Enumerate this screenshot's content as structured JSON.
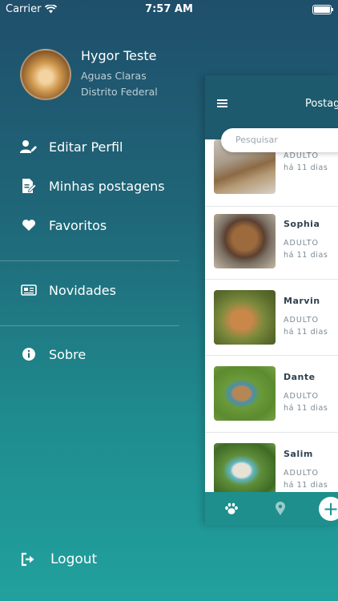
{
  "status_bar": {
    "carrier": "Carrier",
    "time": "7:57 AM"
  },
  "profile": {
    "name": "Hygor Teste",
    "city": "Aguas Claras",
    "state": "Distrito Federal"
  },
  "menu": {
    "edit_profile": "Editar Perfil",
    "my_posts": "Minhas postagens",
    "favorites": "Favoritos",
    "news": "Novidades",
    "about": "Sobre",
    "logout": "Logout"
  },
  "panel": {
    "title": "Postagens",
    "search_placeholder": "Pesquisar",
    "posts": [
      {
        "name": "",
        "age": "ADULTO",
        "time": "há 11 dias"
      },
      {
        "name": "Sophia",
        "age": "ADULTO",
        "time": "há 11 dias"
      },
      {
        "name": "Marvin",
        "age": "ADULTO",
        "time": "há 11 dias"
      },
      {
        "name": "Dante",
        "age": "ADULTO",
        "time": "há 11 dias"
      },
      {
        "name": "Salim",
        "age": "ADULTO",
        "time": "há 11 dias"
      }
    ],
    "fab_label": "+"
  },
  "colors": {
    "panel_header": "#1e5a6e",
    "tabbar": "#1e8f8d",
    "accent": "#21a19d"
  }
}
